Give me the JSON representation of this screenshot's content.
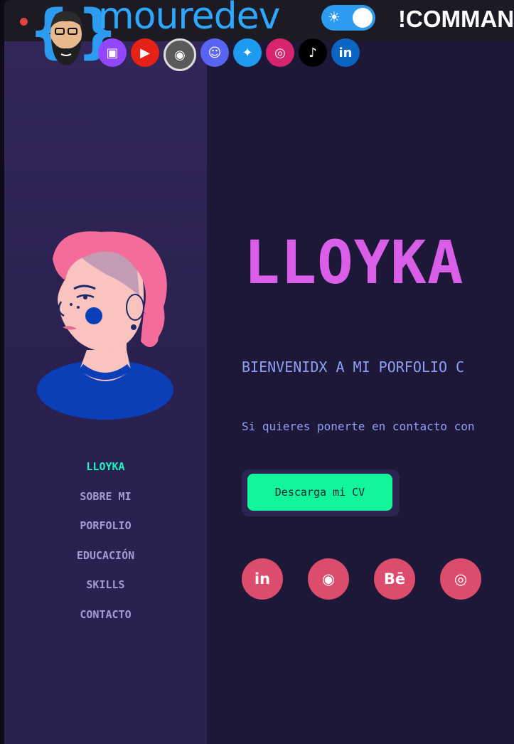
{
  "overlay": {
    "brand": "mouredev",
    "command": "!COMMAN",
    "toggle_icon": "sun-icon",
    "socials": [
      {
        "name": "twitch-icon",
        "glyph": "▣",
        "color": "#9146ff"
      },
      {
        "name": "youtube-icon",
        "glyph": "▶",
        "color": "#e62117"
      },
      {
        "name": "github-icon",
        "glyph": "◉",
        "color": "#5a5a5a"
      },
      {
        "name": "discord-icon",
        "glyph": "☺",
        "color": "#5865f2"
      },
      {
        "name": "twitter-icon",
        "glyph": "✦",
        "color": "#1d9bf0"
      },
      {
        "name": "instagram-icon",
        "glyph": "◎",
        "color": "#d6246e"
      },
      {
        "name": "tiktok-icon",
        "glyph": "♪",
        "color": "#000000"
      },
      {
        "name": "linkedin-icon",
        "glyph": "in",
        "color": "#0a66c2"
      }
    ]
  },
  "sidebar": {
    "nav": [
      {
        "label": "LLOYKA",
        "active": true
      },
      {
        "label": "SOBRE MI",
        "active": false
      },
      {
        "label": "PORFOLIO",
        "active": false
      },
      {
        "label": "EDUCACIÓN",
        "active": false
      },
      {
        "label": "SKILLS",
        "active": false
      },
      {
        "label": "CONTACTO",
        "active": false
      }
    ]
  },
  "main": {
    "name": "LLOYKA",
    "welcome": "BIENVENIDX A MI PORFOLIO C",
    "contact_line": "Si quieres ponerte en contacto con",
    "cv_button": "Descarga mi CV",
    "socials": [
      {
        "name": "linkedin-icon",
        "glyph": "in"
      },
      {
        "name": "github-icon",
        "glyph": "◉"
      },
      {
        "name": "behance-icon",
        "glyph": "Bē"
      },
      {
        "name": "instagram-icon",
        "glyph": "◎"
      }
    ]
  },
  "colors": {
    "accent_pink": "#d95ee8",
    "accent_teal": "#19f2c4",
    "button_green": "#12f59a",
    "social_red": "#dc4d6d",
    "brand_blue": "#2ea8ff"
  }
}
